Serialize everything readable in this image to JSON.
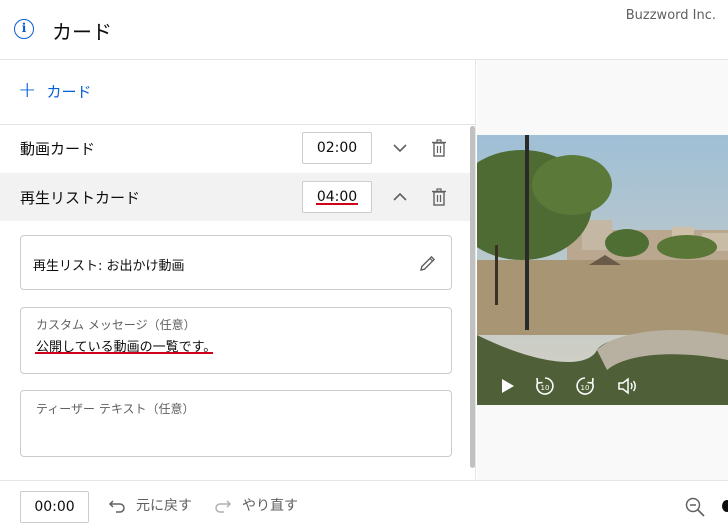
{
  "header": {
    "title": "カード",
    "watermark": "Buzzword Inc."
  },
  "add_card": {
    "label": "カード"
  },
  "cards": [
    {
      "label": "動画カード",
      "time": "02:00",
      "chevron": "chevron-down-icon"
    },
    {
      "label": "再生リストカード",
      "time": "04:00",
      "chevron": "chevron-up-icon"
    }
  ],
  "playlist_field": {
    "text": "再生リスト: お出かけ動画"
  },
  "custom_message": {
    "placeholder": "カスタム メッセージ（任意）",
    "value": "公開している動画の一覧です。"
  },
  "teaser_text": {
    "placeholder": "ティーザー テキスト（任意）"
  },
  "footer": {
    "time": "00:00",
    "undo_label": "元に戻す",
    "redo_label": "やり直す"
  },
  "colors": {
    "accent": "#065fd4",
    "highlight_underline": "#d0021b",
    "selected_row": "#f2f2f2"
  }
}
